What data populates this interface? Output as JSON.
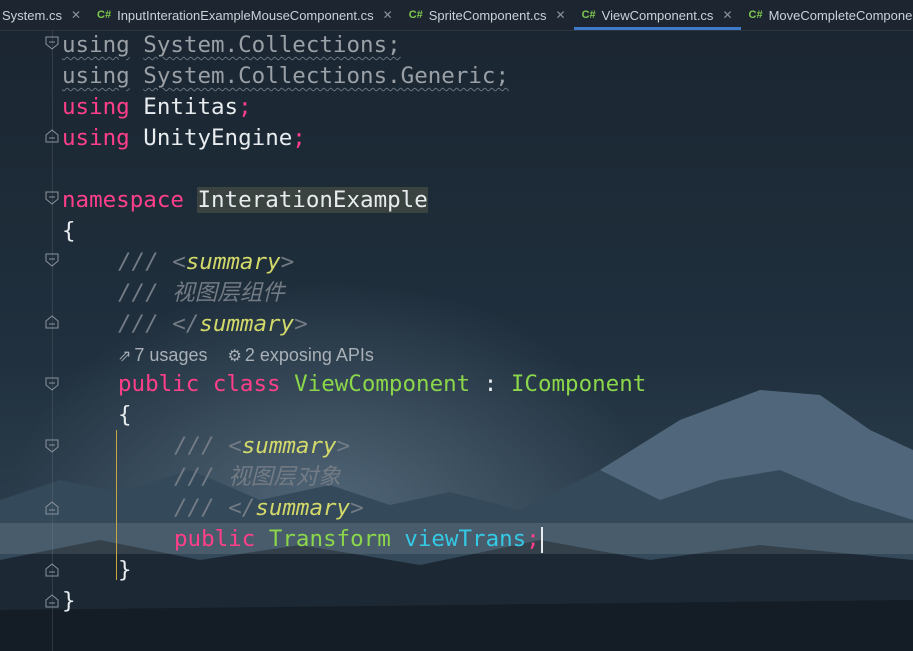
{
  "tabs": [
    {
      "label": "System.cs",
      "has_icon": false
    },
    {
      "label": "InputInterationExampleMouseComponent.cs",
      "has_icon": true
    },
    {
      "label": "SpriteComponent.cs",
      "has_icon": true
    },
    {
      "label": "ViewComponent.cs",
      "has_icon": true,
      "active": true
    },
    {
      "label": "MoveCompleteComponent.cs",
      "has_icon": true
    }
  ],
  "file_icon": "C#",
  "code": {
    "l1_kw": "using",
    "l1_ns": "System.Collections;",
    "l2_kw": "using",
    "l2_ns": "System.Collections.Generic;",
    "l3_kw": "using",
    "l3_ns": "Entitas",
    "l4_kw": "using",
    "l4_ns": "UnityEngine",
    "semi": ";",
    "ns_kw": "namespace",
    "ns_name": "InterationExample",
    "open_brace": "{",
    "close_brace": "}",
    "doc_prefix": "/// ",
    "doc_open_lt": "<",
    "doc_tag": "summary",
    "doc_gt": ">",
    "doc_close_lt": "</",
    "class_summary": "视图层组件",
    "usages": "7 usages",
    "exposing": "2 exposing APIs",
    "public_kw": "public",
    "class_kw": "class",
    "class_name": "ViewComponent",
    "colon": " : ",
    "iface": "IComponent",
    "field_summary": "视图层对象",
    "field_type": "Transform",
    "field_name": "viewTrans"
  }
}
